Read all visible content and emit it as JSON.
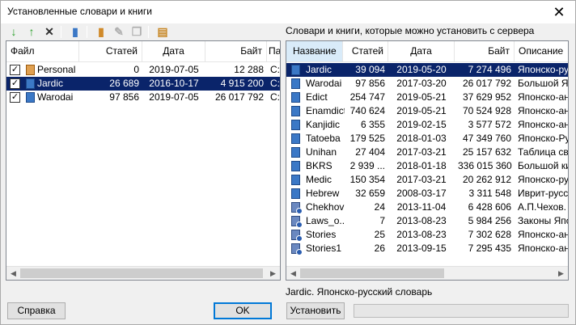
{
  "window": {
    "title": "Установленные словари и книги",
    "close_glyph": "✕"
  },
  "toolbar": {
    "buttons": [
      {
        "name": "move-down-icon",
        "glyph": "↓",
        "color": "#2aa02a"
      },
      {
        "name": "move-up-icon",
        "glyph": "↑",
        "color": "#2aa02a"
      },
      {
        "name": "delete-icon",
        "glyph": "✕",
        "color": "#303030"
      },
      {
        "name": "book-icon",
        "glyph": "▮",
        "color": "#3b78c6"
      },
      {
        "name": "edit-book-icon",
        "glyph": "▮",
        "color": "#d08a2a"
      },
      {
        "name": "pencil-icon",
        "glyph": "✎",
        "color": "#b0b0b0"
      },
      {
        "name": "copy-icon",
        "glyph": "❐",
        "color": "#b0b0b0"
      },
      {
        "name": "properties-icon",
        "glyph": "▤",
        "color": "#c88a2a"
      }
    ]
  },
  "installed": {
    "columns": [
      "Файл",
      "Статей",
      "Дата",
      "Байт",
      "Па"
    ],
    "rows": [
      {
        "checked": true,
        "icon": "ed",
        "name": "Personal",
        "articles": "0",
        "date": "2019-07-05",
        "bytes": "12 288",
        "path": "C:",
        "selected": false
      },
      {
        "checked": true,
        "icon": "book",
        "name": "Jardic",
        "articles": "26 689",
        "date": "2016-10-17",
        "bytes": "4 915 200",
        "path": "C:",
        "selected": true
      },
      {
        "checked": true,
        "icon": "book",
        "name": "Warodai",
        "articles": "97 856",
        "date": "2019-07-05",
        "bytes": "26 017 792",
        "path": "C:",
        "selected": false
      }
    ]
  },
  "server": {
    "heading": "Словари и книги, которые можно установить с сервера",
    "columns": [
      "Название",
      "Статей",
      "Дата",
      "Байт",
      "Описание"
    ],
    "rows": [
      {
        "icon": "book",
        "name": "Jardic",
        "articles": "39 094",
        "date": "2019-05-20",
        "bytes": "7 274 496",
        "desc": "Японско-русский",
        "selected": true
      },
      {
        "icon": "book",
        "name": "Warodai",
        "articles": "97 856",
        "date": "2017-03-20",
        "bytes": "26 017 792",
        "desc": "Большой Японско",
        "selected": false
      },
      {
        "icon": "book",
        "name": "Edict",
        "articles": "254 747",
        "date": "2019-05-21",
        "bytes": "37 629 952",
        "desc": "Японско-англ",
        "selected": false
      },
      {
        "icon": "book",
        "name": "Enamdict",
        "articles": "740 624",
        "date": "2019-05-21",
        "bytes": "70 524 928",
        "desc": "Японско-англ",
        "selected": false
      },
      {
        "icon": "book",
        "name": "Kanjidic",
        "articles": "6 355",
        "date": "2019-02-15",
        "bytes": "3 577 572",
        "desc": "Японско-англ",
        "selected": false
      },
      {
        "icon": "book",
        "name": "Tatoeba",
        "articles": "179 525",
        "date": "2018-01-03",
        "bytes": "47 349 760",
        "desc": "Японско-Русс",
        "selected": false
      },
      {
        "icon": "book",
        "name": "Unihan",
        "articles": "27 404",
        "date": "2017-03-21",
        "bytes": "25 157 632",
        "desc": "Таблица сво",
        "selected": false
      },
      {
        "icon": "book",
        "name": "BKRS",
        "articles": "2 939 ...",
        "date": "2018-01-18",
        "bytes": "336 015 360",
        "desc": "Большой кит",
        "selected": false
      },
      {
        "icon": "book",
        "name": "Medic",
        "articles": "150 354",
        "date": "2017-03-21",
        "bytes": "20 262 912",
        "desc": "Японско-рус",
        "selected": false
      },
      {
        "icon": "book",
        "name": "Hebrew",
        "articles": "32 659",
        "date": "2008-03-17",
        "bytes": "3 311 548",
        "desc": "Иврит-русск",
        "selected": false
      },
      {
        "icon": "multi",
        "name": "Chekhov",
        "articles": "24",
        "date": "2013-11-04",
        "bytes": "6 428 606",
        "desc": "А.П.Чехов. С",
        "selected": false
      },
      {
        "icon": "multi",
        "name": "Laws_o...",
        "articles": "7",
        "date": "2013-08-23",
        "bytes": "5 984 256",
        "desc": "Законы Япо",
        "selected": false
      },
      {
        "icon": "multi",
        "name": "Stories",
        "articles": "25",
        "date": "2013-08-23",
        "bytes": "7 302 628",
        "desc": "Японско-анг",
        "selected": false
      },
      {
        "icon": "multi",
        "name": "Stories1",
        "articles": "26",
        "date": "2013-09-15",
        "bytes": "7 295 435",
        "desc": "Японско-анг",
        "selected": false
      }
    ],
    "status": "Jardic. Японско-русский словарь"
  },
  "buttons": {
    "help": "Справка",
    "ok": "OK",
    "install": "Установить"
  },
  "colors": {
    "selection": "#0a246a",
    "accent": "#0078d7"
  }
}
